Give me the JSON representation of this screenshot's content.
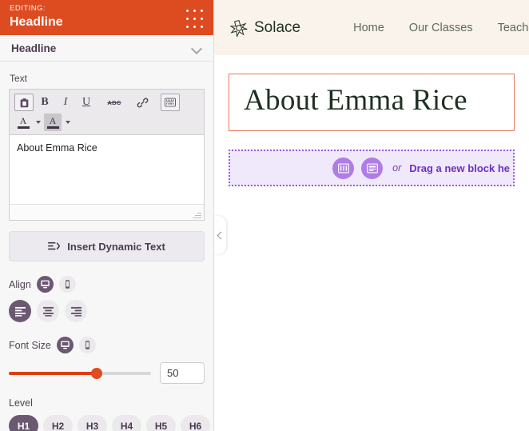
{
  "editor_panel": {
    "header": {
      "eyebrow": "EDITING:",
      "title": "Headline",
      "drag_handle_icon": "grid-dots-icon",
      "accent_color": "#dd4b21"
    },
    "section": {
      "label": "Headline",
      "collapse_icon": "chevron-down-icon"
    },
    "text_field": {
      "label": "Text",
      "value": "About Emma Rice",
      "placeholder": "",
      "resize_grip_icon": "resize-grip-icon"
    },
    "toolbar": {
      "row1": [
        {
          "icon": "paste-clipboard-icon",
          "label": "",
          "active": true
        },
        {
          "icon": "bold-icon",
          "label": "B",
          "active": false
        },
        {
          "icon": "italic-icon",
          "label": "I",
          "active": false
        },
        {
          "icon": "underline-icon",
          "label": "U",
          "active": false
        },
        {
          "icon": "strikethrough-icon",
          "label": "ABC",
          "active": false
        },
        {
          "icon": "link-icon",
          "label": "",
          "active": false
        },
        {
          "icon": "source-code-icon",
          "label": "",
          "active": true
        }
      ],
      "row2": [
        {
          "icon": "text-color-icon",
          "label": "A",
          "active": false
        },
        {
          "icon": "highlight-color-icon",
          "label": "A",
          "active": true
        }
      ]
    },
    "dynamic_text_button": {
      "label": "Insert Dynamic Text",
      "icon": "dynamic-text-icon"
    },
    "align": {
      "label": "Align",
      "devices": [
        {
          "icon": "desktop-icon",
          "active": true
        },
        {
          "icon": "mobile-icon",
          "active": false
        }
      ],
      "options": [
        {
          "icon": "align-left-icon",
          "active": true
        },
        {
          "icon": "align-center-icon",
          "active": false
        },
        {
          "icon": "align-right-icon",
          "active": false
        }
      ]
    },
    "font_size": {
      "label": "Font Size",
      "devices": [
        {
          "icon": "desktop-icon",
          "active": true
        },
        {
          "icon": "mobile-icon",
          "active": false
        }
      ],
      "value": "50",
      "percent": 62,
      "fill_color": "#dd3e16"
    },
    "level": {
      "label": "Level",
      "options": [
        "H1",
        "H2",
        "H3",
        "H4",
        "H5",
        "H6"
      ],
      "selected": "H1"
    }
  },
  "preview": {
    "collapse_handle_icon": "chevron-left-icon",
    "site": {
      "logo_icon": "star-mandala-icon",
      "brand_name": "Solace",
      "nav": [
        "Home",
        "Our Classes",
        "Teache"
      ],
      "header_bg": "#faf3ec"
    },
    "headline": {
      "text": "About Emma Rice",
      "selected_border_color": "#e8795c",
      "text_color": "#1e3022"
    },
    "dropzone": {
      "icons": [
        "columns-block-icon",
        "content-block-icon"
      ],
      "or_label": "or",
      "text": "Drag a new block he",
      "border_color": "#9b59e0",
      "bg_color": "#f0e8fb"
    }
  }
}
